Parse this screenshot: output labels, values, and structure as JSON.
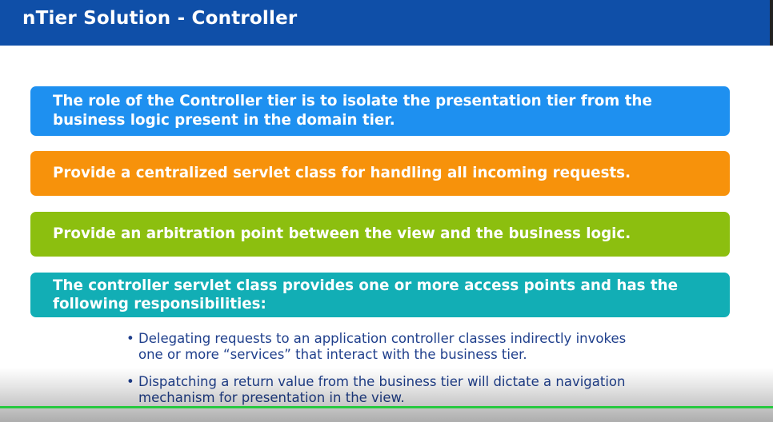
{
  "slide": {
    "title": "nTier Solution - Controller"
  },
  "boxes": [
    {
      "text": "The role of the Controller tier is to isolate the presentation tier from the business logic present in the domain tier.",
      "color": "#1e90f0"
    },
    {
      "text": "Provide a centralized servlet class for handling all incoming requests.",
      "color": "#f7920b"
    },
    {
      "text": "Provide an arbitration point between the view and the business logic.",
      "color": "#8cbf0f"
    },
    {
      "text": "The controller servlet class provides one or more access points and has the following responsibilities:",
      "color": "#12aeb5"
    }
  ],
  "bullets": [
    "Delegating requests to an application controller classes indirectly invokes one or more “services” that interact with the business tier.",
    "Dispatching a return value from the business tier will dictate a navigation mechanism for presentation in the view."
  ],
  "colors": {
    "title_bar": "#0f4fa8",
    "bullet_text": "#1f3f8c",
    "progress": "#27c93f"
  },
  "player": {
    "progress": 1.0
  }
}
